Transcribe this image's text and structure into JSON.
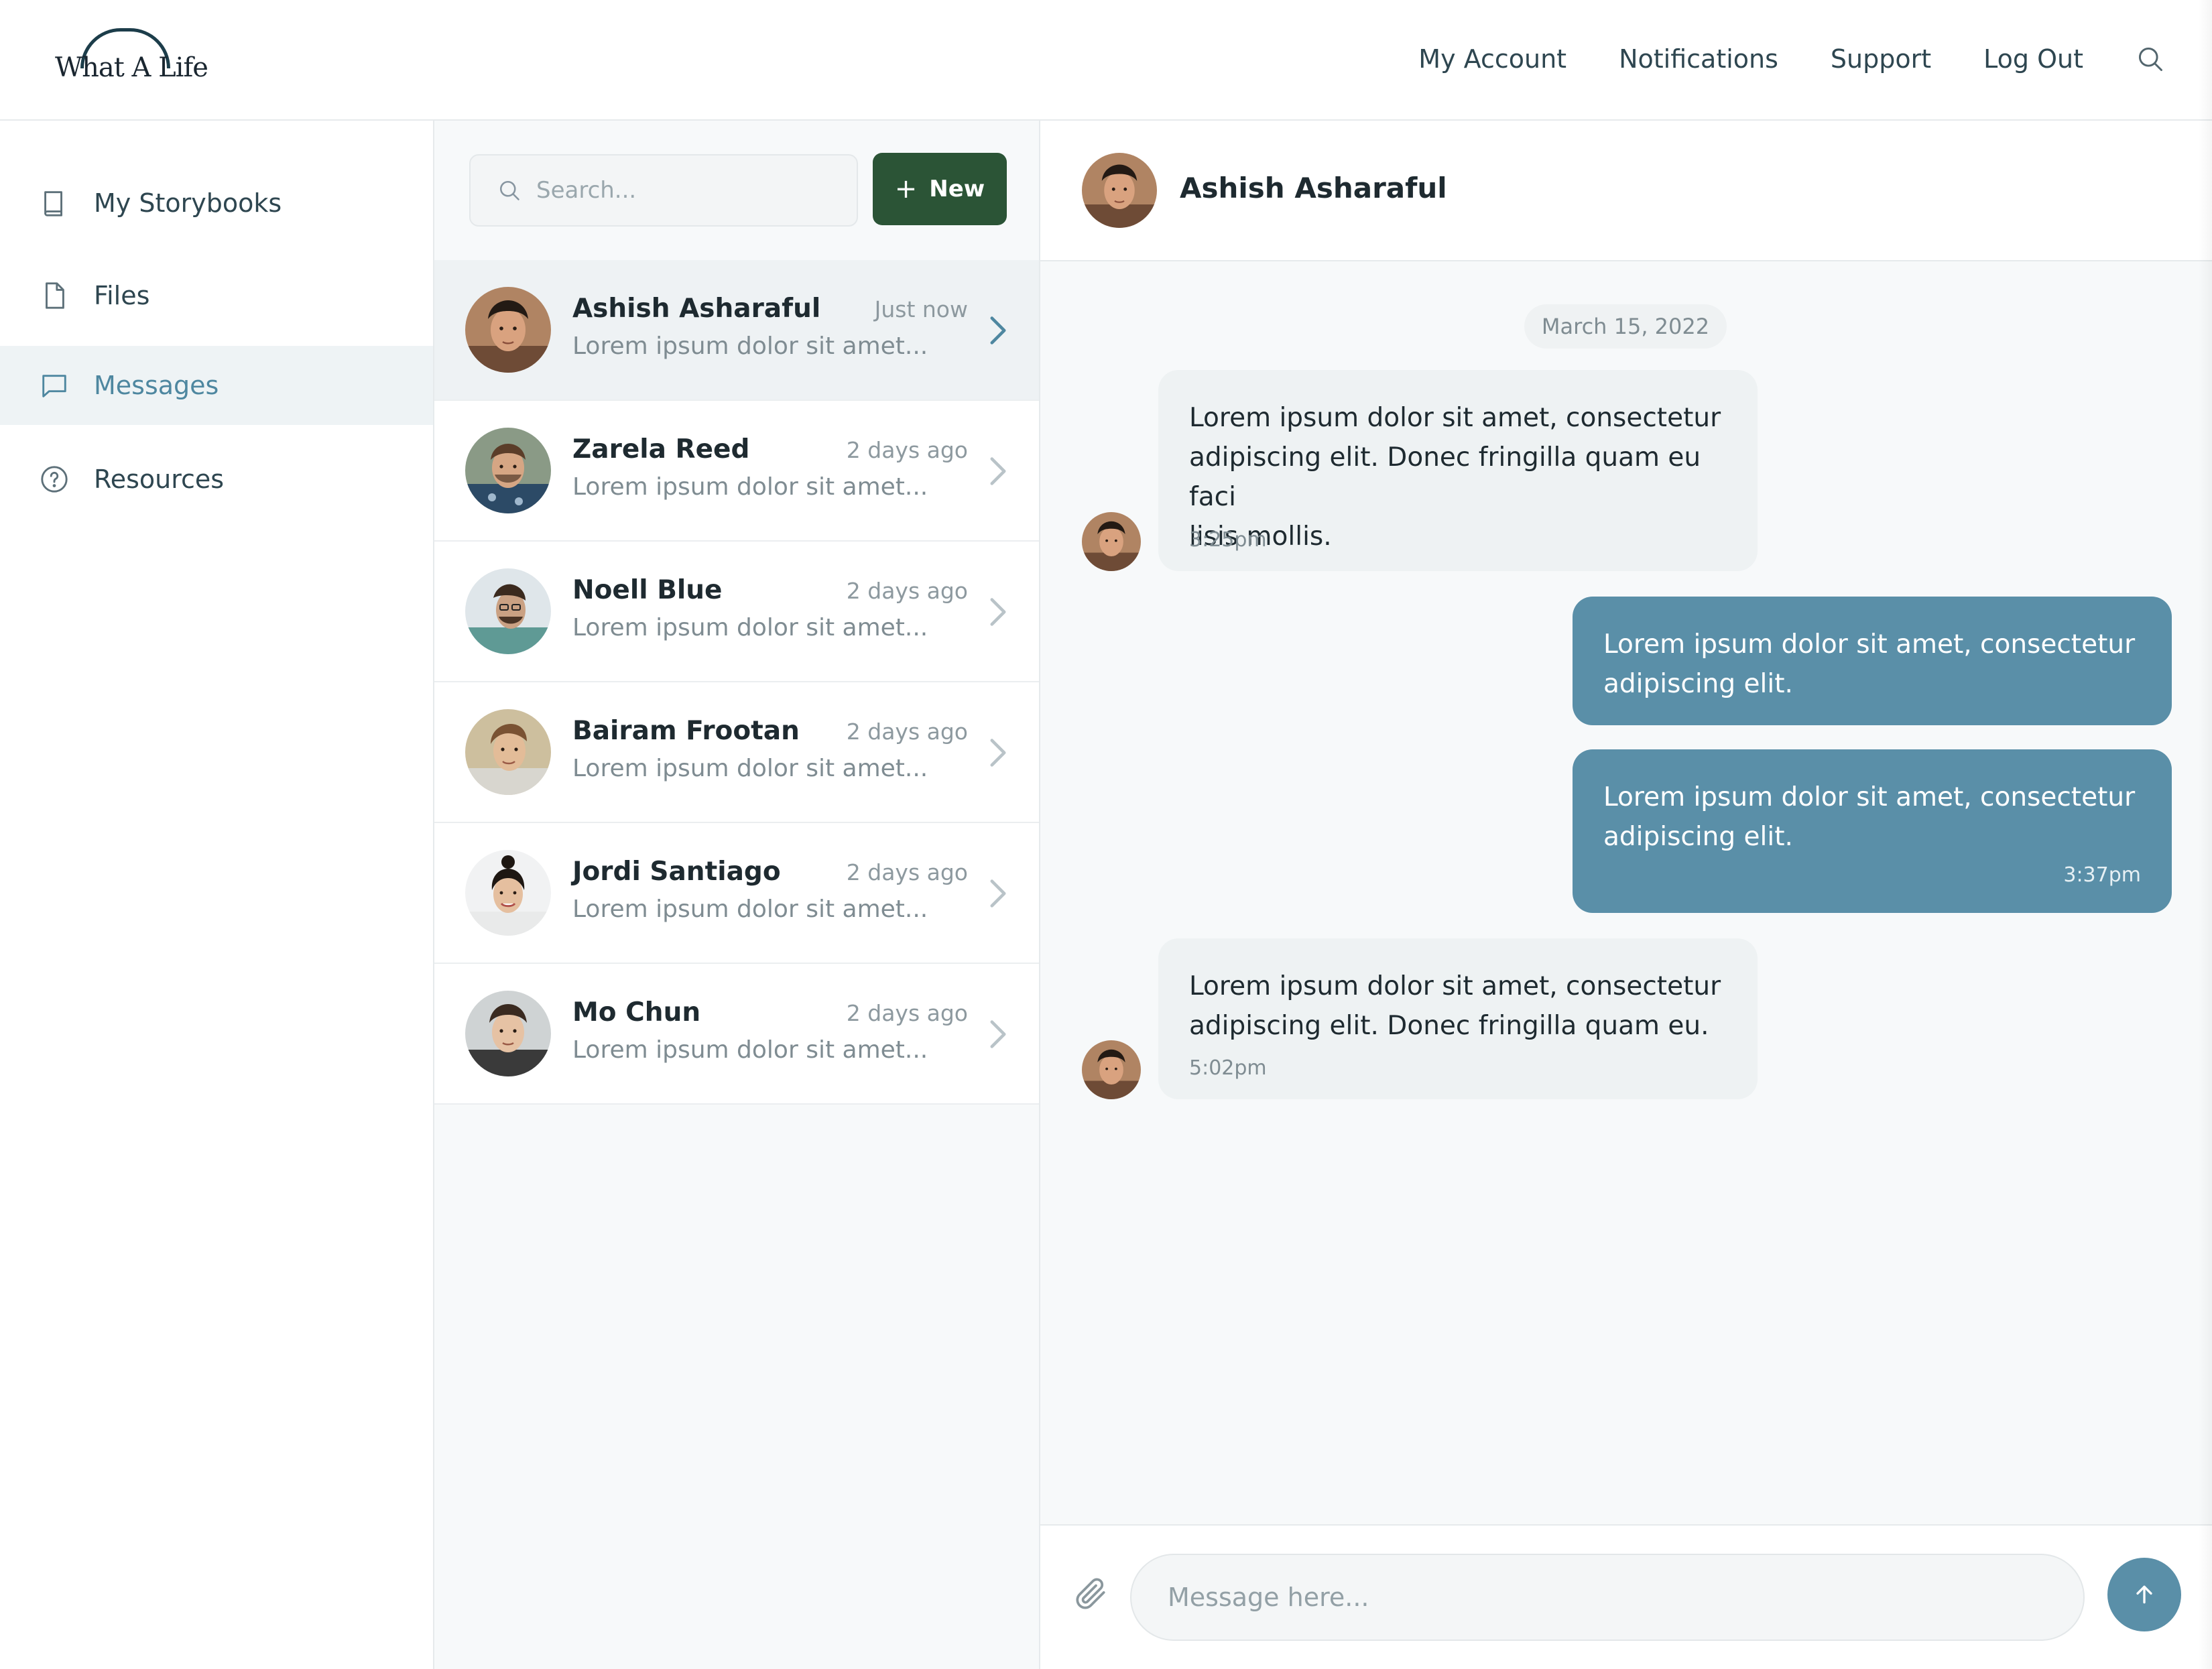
{
  "logo": {
    "text": "What A Life"
  },
  "topnav": {
    "items": [
      {
        "label": "My Account"
      },
      {
        "label": "Notifications"
      },
      {
        "label": "Support"
      },
      {
        "label": "Log Out"
      }
    ],
    "search_icon": "search-icon"
  },
  "sidebar": {
    "items": [
      {
        "label": "My Storybooks",
        "icon": "book-icon",
        "active": false
      },
      {
        "label": "Files",
        "icon": "file-icon",
        "active": false
      },
      {
        "label": "Messages",
        "icon": "chat-bubble-icon",
        "active": true
      },
      {
        "label": "Resources",
        "icon": "help-circle-icon",
        "active": false
      }
    ]
  },
  "conversations": {
    "search_placeholder": "Search...",
    "new_button": "New",
    "items": [
      {
        "name": "Ashish Asharaful",
        "time": "Just now",
        "preview": "Lorem ipsum dolor sit amet...",
        "active": true
      },
      {
        "name": "Zarela Reed",
        "time": "2 days ago",
        "preview": "Lorem ipsum dolor sit amet...",
        "active": false
      },
      {
        "name": "Noell Blue",
        "time": "2 days ago",
        "preview": "Lorem ipsum dolor sit amet...",
        "active": false
      },
      {
        "name": "Bairam Frootan",
        "time": "2 days ago",
        "preview": "Lorem ipsum dolor sit amet...",
        "active": false
      },
      {
        "name": "Jordi Santiago",
        "time": "2 days ago",
        "preview": "Lorem ipsum dolor sit amet...",
        "active": false
      },
      {
        "name": "Mo Chun",
        "time": "2 days ago",
        "preview": "Lorem ipsum dolor sit amet...",
        "active": false
      }
    ]
  },
  "chat": {
    "contact_name": "Ashish Asharaful",
    "date": "March 15, 2022",
    "messages": [
      {
        "direction": "in",
        "lines": [
          "Lorem ipsum dolor sit amet, consectetur",
          "adipiscing elit. Donec fringilla quam eu faci",
          "lisis mollis."
        ],
        "time": "3:25pm"
      },
      {
        "direction": "out",
        "lines": [
          "Lorem ipsum dolor sit amet, consectetur",
          "adipiscing elit."
        ],
        "time": ""
      },
      {
        "direction": "out",
        "lines": [
          "Lorem ipsum dolor sit amet, consectetur",
          "adipiscing elit."
        ],
        "time": "3:37pm"
      },
      {
        "direction": "in",
        "lines": [
          "Lorem ipsum dolor sit amet, consectetur",
          "adipiscing elit. Donec fringilla quam eu."
        ],
        "time": "5:02pm"
      }
    ],
    "input_placeholder": "Message here...",
    "attach_icon": "paperclip-icon",
    "send_icon": "arrow-up-icon"
  },
  "colors": {
    "accent": "#5a8fa8",
    "new_button": "#2b5436",
    "active_nav_text": "#4e87a0",
    "active_bg": "#eef3f5"
  }
}
